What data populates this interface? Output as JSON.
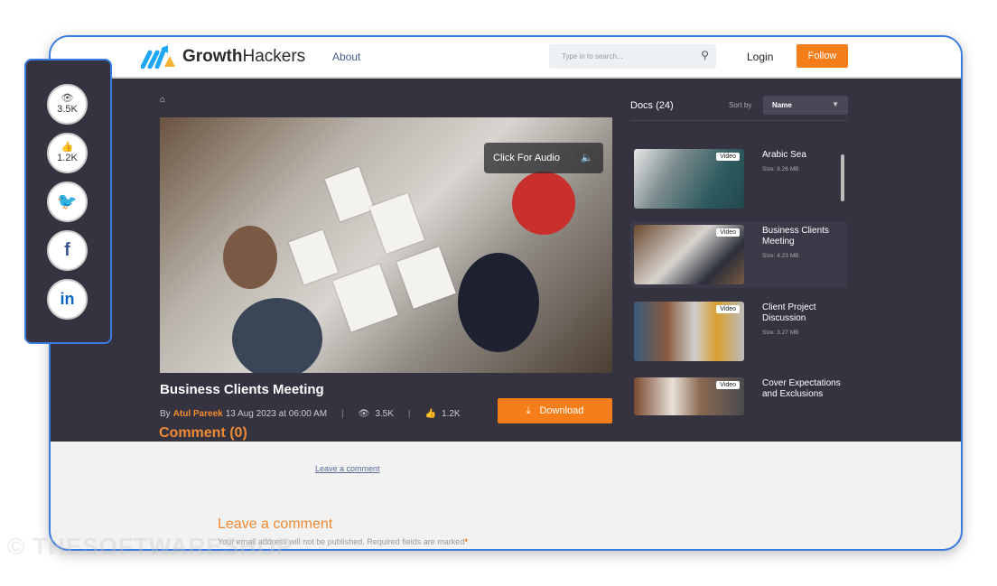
{
  "header": {
    "logo_bold": "Growth",
    "logo_rest": "Hackers",
    "nav_about": "About",
    "search_placeholder": "Type in to search...",
    "login": "Login",
    "follow": "Follow"
  },
  "video": {
    "audio_label": "Click For Audio",
    "title": "Business Clients Meeting",
    "by": "By",
    "author": "Atul Pareek",
    "date": "13 Aug 2023 at 06:00 AM",
    "views": "3.5K",
    "likes": "1.2K",
    "download": "Download"
  },
  "docs": {
    "title": "Docs (24)",
    "sort_label": "Sort by",
    "sort_value": "Name",
    "items": [
      {
        "name": "Arabic Sea",
        "size": "Size: 8.26 MB",
        "badge": "Video"
      },
      {
        "name": "Business Clients Meeting",
        "size": "Size: 4.23 MB",
        "badge": "Video"
      },
      {
        "name": "Client Project Discussion",
        "size": "Size: 3.27 MB",
        "badge": "Video"
      },
      {
        "name": "Cover Expectations and Exclusions",
        "size": "",
        "badge": "Video"
      }
    ]
  },
  "comments": {
    "heading": "Comment (0)",
    "leave_link": "Leave a comment",
    "leave_heading": "Leave a comment",
    "note": "Your email address will not be published. Required fields are marked",
    "required_mark": "*"
  },
  "social": {
    "views": "3.5K",
    "likes": "1.2K"
  },
  "watermark": "© THESOFTWARESHOP",
  "colors": {
    "accent": "#f57e1a",
    "dark_bg": "#353340",
    "border": "#3b7be0"
  }
}
